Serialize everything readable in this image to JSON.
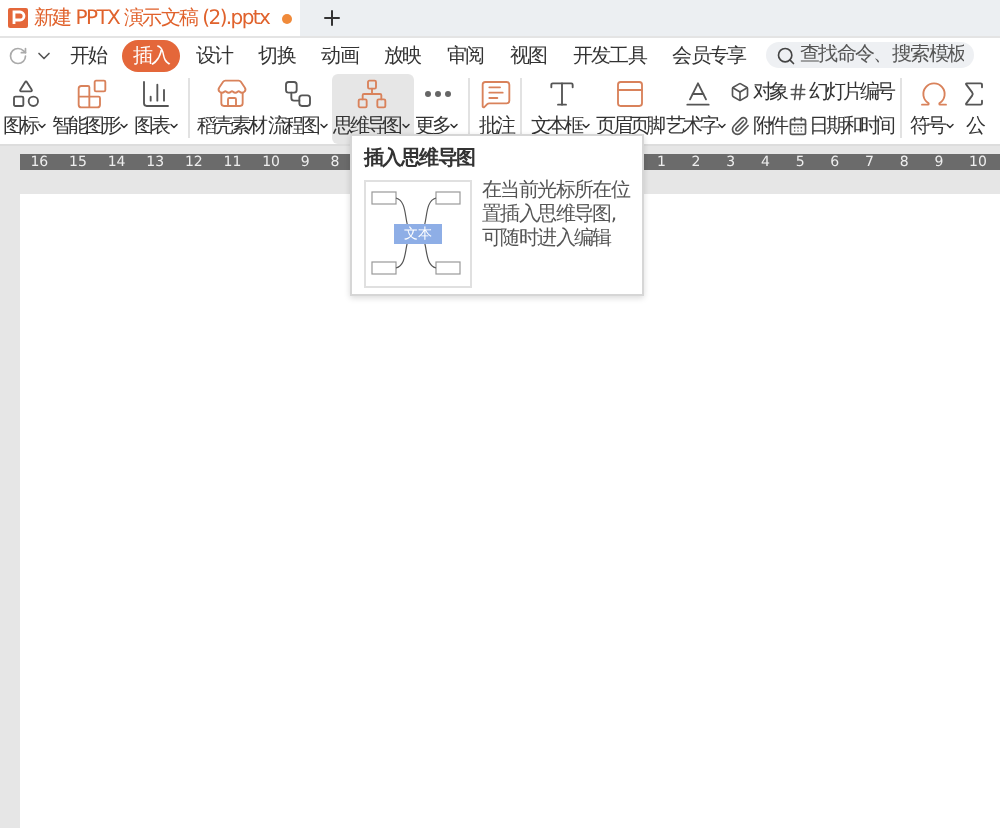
{
  "title_bar": {
    "tab_title": "新建 PPTX 演示文稿 (2).pptx",
    "unsaved": true
  },
  "menu_tabs": [
    {
      "label": "开始",
      "selected": false
    },
    {
      "label": "插入",
      "selected": true
    },
    {
      "label": "设计",
      "selected": false
    },
    {
      "label": "切换",
      "selected": false
    },
    {
      "label": "动画",
      "selected": false
    },
    {
      "label": "放映",
      "selected": false
    },
    {
      "label": "审阅",
      "selected": false
    },
    {
      "label": "视图",
      "selected": false
    },
    {
      "label": "开发工具",
      "selected": false
    },
    {
      "label": "会员专享",
      "selected": false
    }
  ],
  "search": {
    "placeholder": "查找命令、搜索模板"
  },
  "ribbon": [
    {
      "kind": "large",
      "label": "图标",
      "dropdown": true,
      "selected": false
    },
    {
      "kind": "large",
      "label": "智能图形",
      "dropdown": true,
      "selected": false
    },
    {
      "kind": "large",
      "label": "图表",
      "dropdown": true,
      "selected": false
    },
    {
      "kind": "separator"
    },
    {
      "kind": "large",
      "label": "稻壳素材",
      "dropdown": false,
      "selected": false
    },
    {
      "kind": "large",
      "label": "流程图",
      "dropdown": true,
      "selected": false
    },
    {
      "kind": "large",
      "label": "思维导图",
      "dropdown": true,
      "selected": true
    },
    {
      "kind": "large",
      "label": "更多",
      "dropdown": true,
      "selected": false
    },
    {
      "kind": "separator"
    },
    {
      "kind": "large",
      "label": "批注",
      "dropdown": false,
      "selected": false
    },
    {
      "kind": "separator"
    },
    {
      "kind": "large",
      "label": "文本框",
      "dropdown": true,
      "selected": false
    },
    {
      "kind": "large",
      "label": "页眉页脚",
      "dropdown": false,
      "selected": false
    },
    {
      "kind": "large",
      "label": "艺术字",
      "dropdown": true,
      "selected": false
    },
    {
      "kind": "stack",
      "items": [
        {
          "label": "对象"
        },
        {
          "label": "附件"
        }
      ]
    },
    {
      "kind": "stack",
      "items": [
        {
          "label": "幻灯片编号"
        },
        {
          "label": "日期和时间"
        }
      ]
    },
    {
      "kind": "separator"
    },
    {
      "kind": "large",
      "label": "符号",
      "dropdown": true,
      "selected": false
    },
    {
      "kind": "large",
      "label": "公",
      "dropdown": false,
      "selected": false
    }
  ],
  "ruler": {
    "left_ticks": [
      "16",
      "15",
      "14",
      "13",
      "12",
      "11",
      "10",
      "9",
      "8"
    ],
    "right_ticks": [
      "1",
      "2",
      "3",
      "4",
      "5",
      "6",
      "7",
      "8",
      "9",
      "10"
    ]
  },
  "popup": {
    "title": "插入思维导图",
    "description": "在当前光标所在位置插入思维导图,可随时进入编辑",
    "preview_node": "文本"
  }
}
